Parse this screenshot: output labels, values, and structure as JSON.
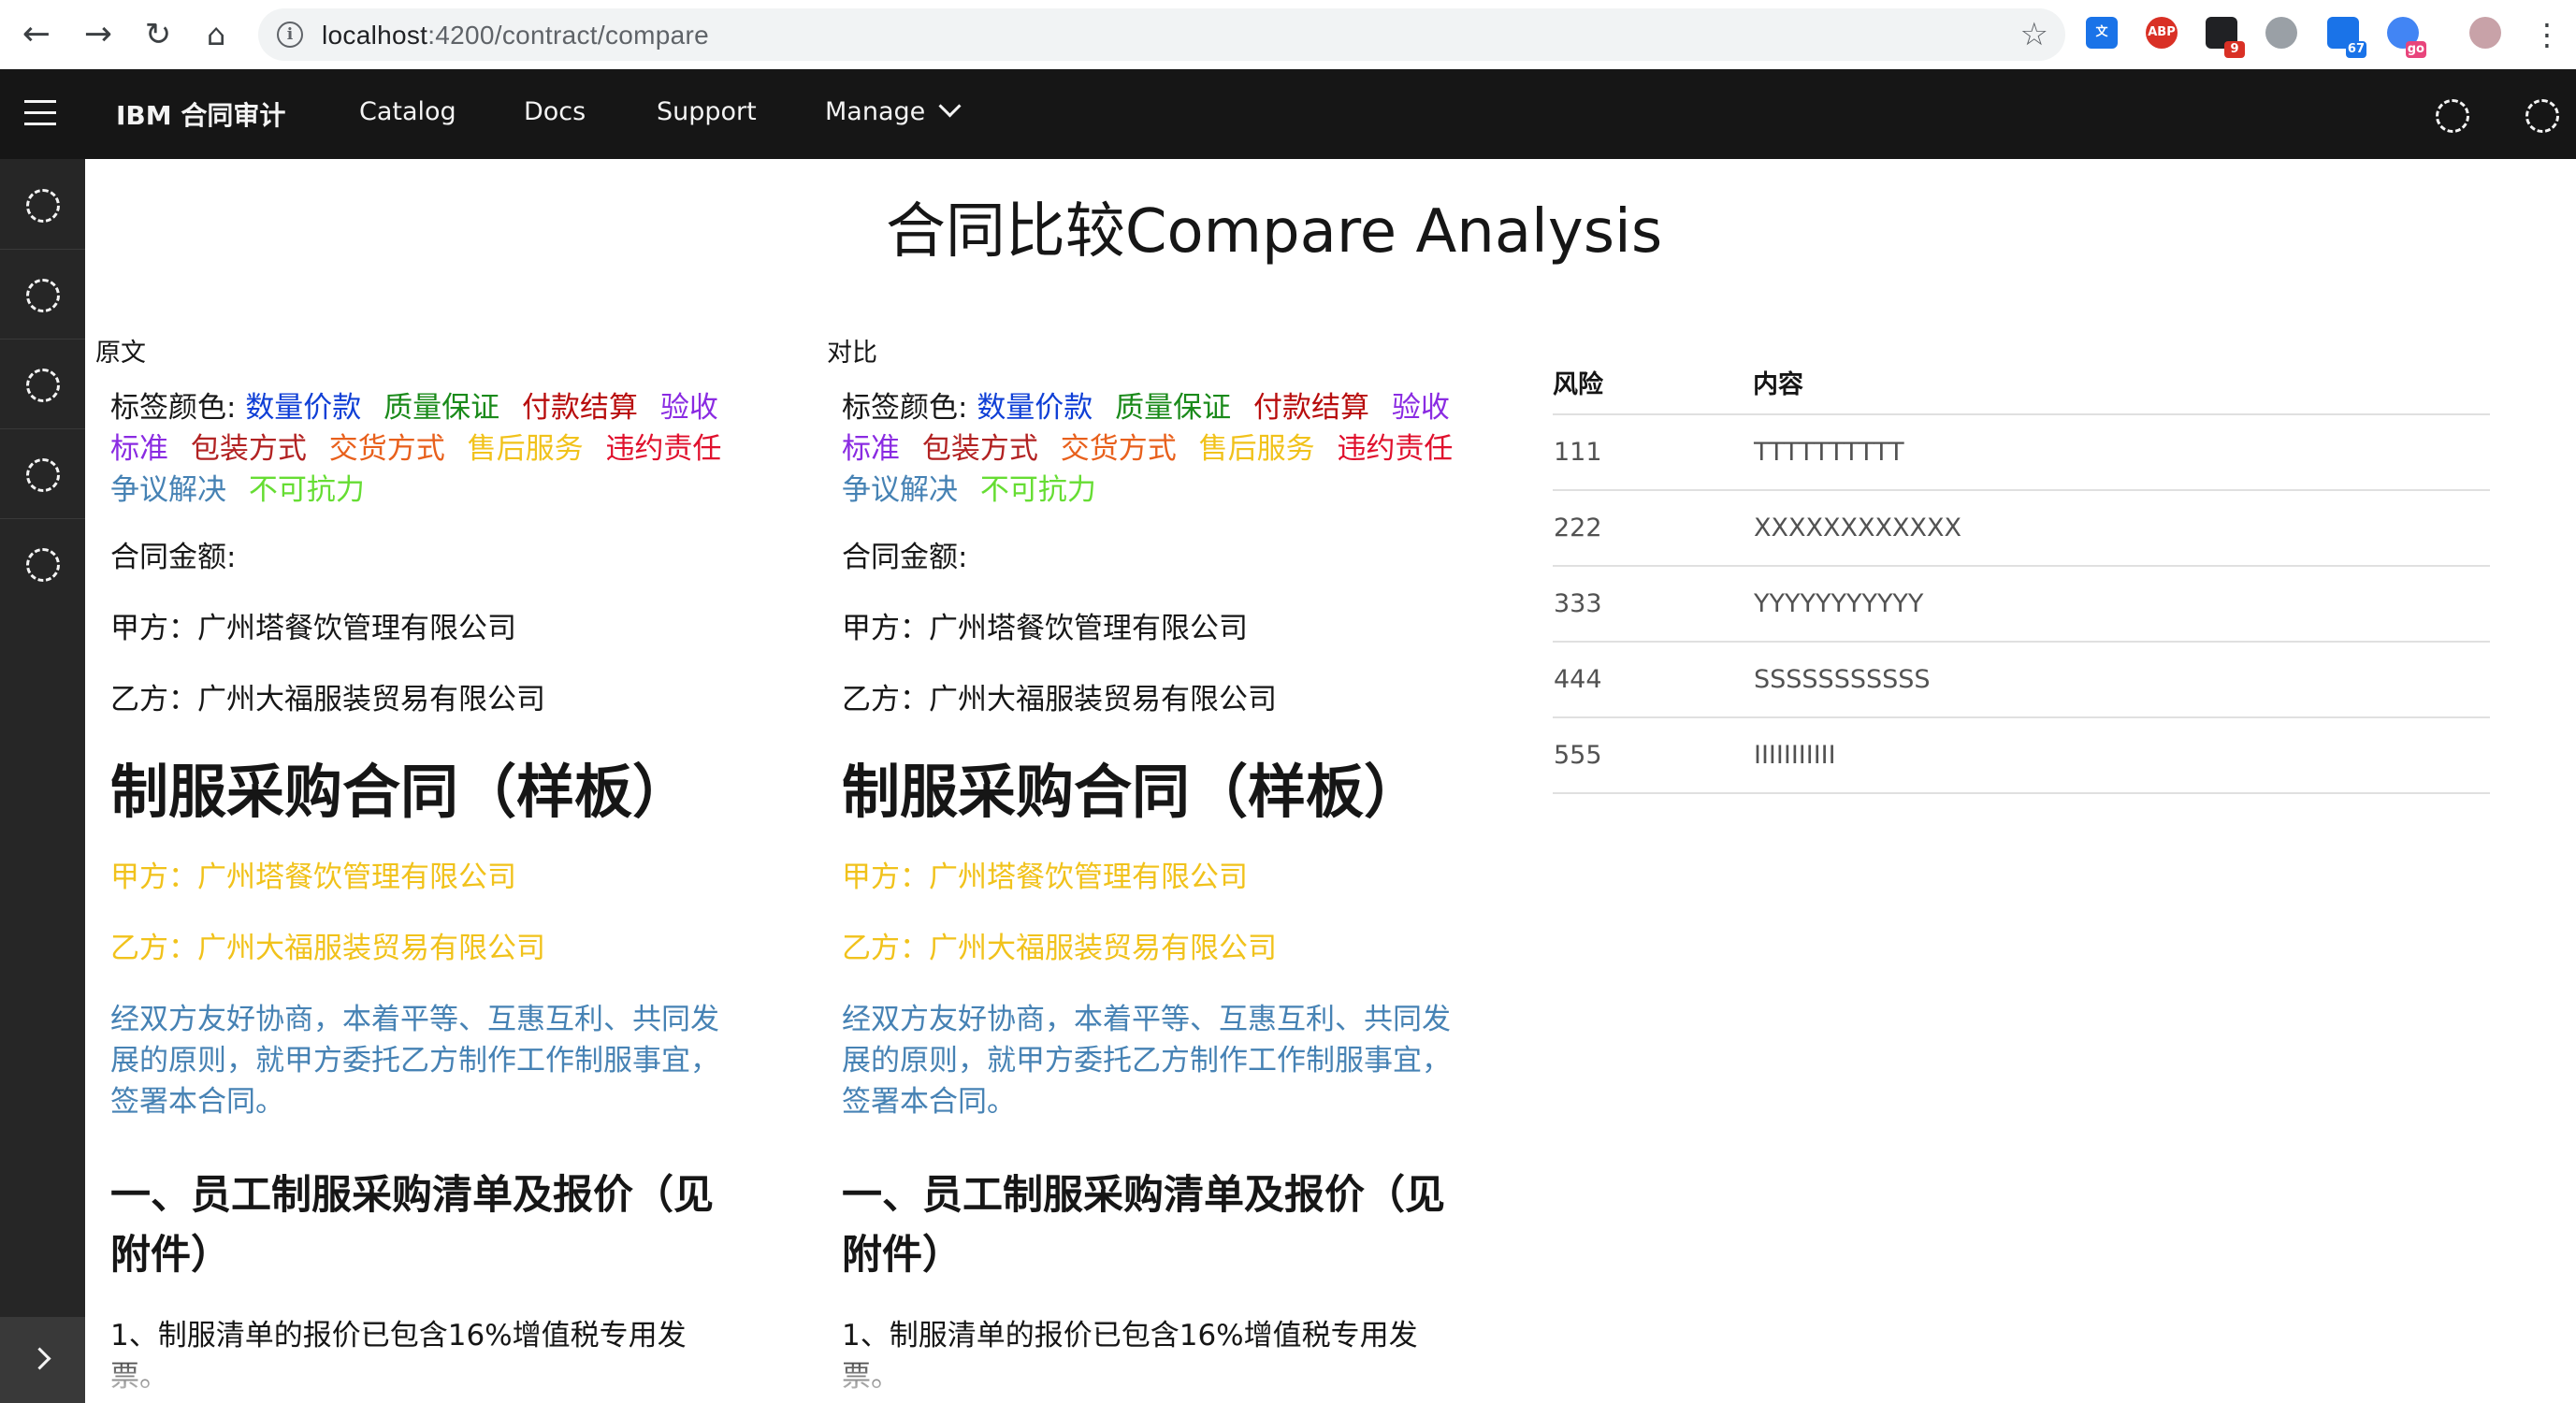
{
  "browser": {
    "url_host": "localhost",
    "url_path": ":4200/contract/compare",
    "ext_badges": [
      "9",
      "67",
      "go"
    ],
    "ext_labels": [
      "ABP"
    ]
  },
  "header": {
    "brand": "IBM 合同审计",
    "nav": [
      "Catalog",
      "Docs",
      "Support",
      "Manage"
    ]
  },
  "page": {
    "title": "合同比较Compare Analysis"
  },
  "colors": {
    "quantity_price": "#0f3fd6",
    "quality": "#1a8a1a",
    "payment": "#b80d0d",
    "acceptance": "#8a2be2",
    "packaging": "#b22222",
    "delivery": "#e8601c",
    "after_sales": "#f1c21b",
    "breach": "#e0102d",
    "dispute": "#4682b4",
    "force_majeure": "#66dd33"
  },
  "columns": [
    {
      "heading": "原文",
      "legend_label": "标签颜色:",
      "tags": {
        "quantity_price": "数量价款",
        "quality": "质量保证",
        "payment": "付款结算",
        "acceptance": "验收标准",
        "packaging": "包装方式",
        "delivery": "交货方式",
        "after_sales": "售后服务",
        "breach": "违约责任",
        "dispute": "争议解决",
        "force_majeure": "不可抗力"
      },
      "amount": "合同金额:",
      "party_a": "甲方：广州塔餐饮管理有限公司",
      "party_b": "乙方：广州大福服装贸易有限公司",
      "doc_title": "制服采购合同（样板）",
      "party_a_tagged": "甲方：广州塔餐饮管理有限公司",
      "party_b_tagged": "乙方：广州大福服装贸易有限公司",
      "intro": "经双方友好协商，本着平等、互惠互利、共同发展的原则，就甲方委托乙方制作工作制服事宜，签署本合同。",
      "section1": "一、员工制服采购清单及报价（见附件）",
      "item1": "1、制服清单的报价已包含16%增值税专用发票。"
    },
    {
      "heading": "对比",
      "legend_label": "标签颜色:",
      "tags": {
        "quantity_price": "数量价款",
        "quality": "质量保证",
        "payment": "付款结算",
        "acceptance": "验收标准",
        "packaging": "包装方式",
        "delivery": "交货方式",
        "after_sales": "售后服务",
        "breach": "违约责任",
        "dispute": "争议解决",
        "force_majeure": "不可抗力"
      },
      "amount": "合同金额:",
      "party_a": "甲方：广州塔餐饮管理有限公司",
      "party_b": "乙方：广州大福服装贸易有限公司",
      "doc_title": "制服采购合同（样板）",
      "party_a_tagged": "甲方：广州塔餐饮管理有限公司",
      "party_b_tagged": "乙方：广州大福服装贸易有限公司",
      "intro": "经双方友好协商，本着平等、互惠互利、共同发展的原则，就甲方委托乙方制作工作制服事宜，签署本合同。",
      "section1": "一、员工制服采购清单及报价（见附件）",
      "item1": "1、制服清单的报价已包含16%增值税专用发票。"
    }
  ],
  "risk_table": {
    "headers": [
      "风险",
      "内容"
    ],
    "rows": [
      [
        "111",
        "TTTTTTTTTT"
      ],
      [
        "222",
        "XXXXXXXXXXXX"
      ],
      [
        "333",
        "YYYYYYYYYYY"
      ],
      [
        "444",
        "SSSSSSSSSSS"
      ],
      [
        "555",
        "IIIIIIIIIII"
      ]
    ]
  }
}
